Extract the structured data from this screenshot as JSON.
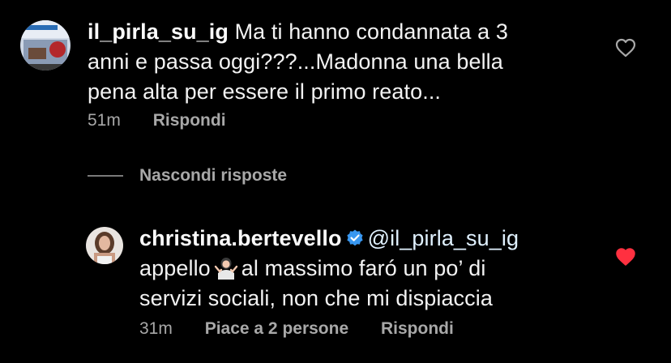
{
  "comment1": {
    "username": "il_pirla_su_ig",
    "text_line1": "Ma ti hanno condannata a 3",
    "text_line2": "anni e passa oggi???...Madonna una bella",
    "text_line3": "pena alta per essere il primo reato...",
    "time": "51m",
    "reply_label": "Rispondi",
    "liked": false
  },
  "hide_replies_label": "Nascondi risposte",
  "reply1": {
    "username": "christina.bertevello",
    "mention": "@il_pirla_su_ig",
    "text_line2_before": "appello",
    "text_line2_after": "al massimo faró un po’ di",
    "text_line3": "servizi sociali, non che mi dispiaccia",
    "time": "31m",
    "likes_label": "Piace a 2 persone",
    "reply_label": "Rispondi",
    "liked": true,
    "verified": true
  },
  "colors": {
    "background": "#000000",
    "text": "#f2f2f2",
    "secondary": "#a8a8a8",
    "like_active": "#ff3040",
    "verified": "#3897f0"
  },
  "icons": {
    "like_outline": "heart-outline-icon",
    "like_filled": "heart-filled-icon",
    "verified": "verified-badge-icon",
    "emoji": "woman-shrugging-emoji"
  }
}
